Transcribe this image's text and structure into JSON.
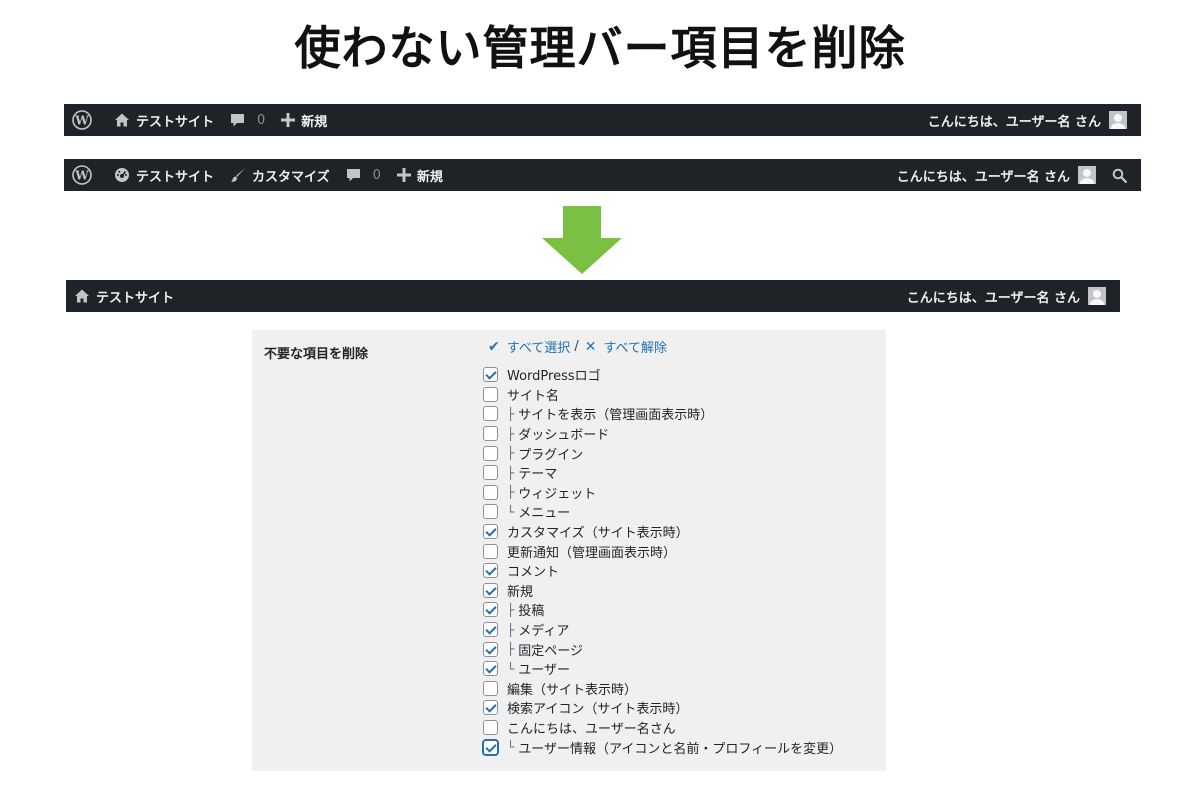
{
  "headline": "使わない管理バー項目を削除",
  "before_bar_site": {
    "site_name": "テストサイト",
    "comments_count": "0",
    "new_label": "新規",
    "greeting": "こんにちは、ユーザー名 さん"
  },
  "before_bar_admin": {
    "site_name": "テストサイト",
    "customize_label": "カスタマイズ",
    "comments_count": "0",
    "new_label": "新規",
    "greeting": "こんにちは、ユーザー名 さん"
  },
  "after_bar": {
    "site_name": "テストサイト",
    "greeting": "こんにちは、ユーザー名 さん"
  },
  "arrow_color": "#7ac143",
  "settings": {
    "label": "不要な項目を削除",
    "select_all": "すべて選択",
    "separator": "/",
    "deselect_all": "すべて解除",
    "options": [
      {
        "tree": "",
        "label": "WordPressロゴ",
        "checked": true
      },
      {
        "tree": "",
        "label": "サイト名",
        "checked": false
      },
      {
        "tree": "├",
        "label": "サイトを表示（管理画面表示時）",
        "checked": false
      },
      {
        "tree": "├",
        "label": "ダッシュボード",
        "checked": false
      },
      {
        "tree": "├",
        "label": "プラグイン",
        "checked": false
      },
      {
        "tree": "├",
        "label": "テーマ",
        "checked": false
      },
      {
        "tree": "├",
        "label": "ウィジェット",
        "checked": false
      },
      {
        "tree": "└",
        "label": "メニュー",
        "checked": false
      },
      {
        "tree": "",
        "label": "カスタマイズ（サイト表示時）",
        "checked": true
      },
      {
        "tree": "",
        "label": "更新通知（管理画面表示時）",
        "checked": false
      },
      {
        "tree": "",
        "label": "コメント",
        "checked": true
      },
      {
        "tree": "",
        "label": "新規",
        "checked": true
      },
      {
        "tree": "├",
        "label": "投稿",
        "checked": true
      },
      {
        "tree": "├",
        "label": "メディア",
        "checked": true
      },
      {
        "tree": "├",
        "label": "固定ページ",
        "checked": true
      },
      {
        "tree": "└",
        "label": "ユーザー",
        "checked": true
      },
      {
        "tree": "",
        "label": "編集（サイト表示時）",
        "checked": false
      },
      {
        "tree": "",
        "label": "検索アイコン（サイト表示時）",
        "checked": true
      },
      {
        "tree": "",
        "label": "こんにちは、ユーザー名さん",
        "checked": false
      },
      {
        "tree": "└",
        "label": "ユーザー情報（アイコンと名前・プロフィールを変更）",
        "checked": true,
        "focused": true
      }
    ]
  }
}
